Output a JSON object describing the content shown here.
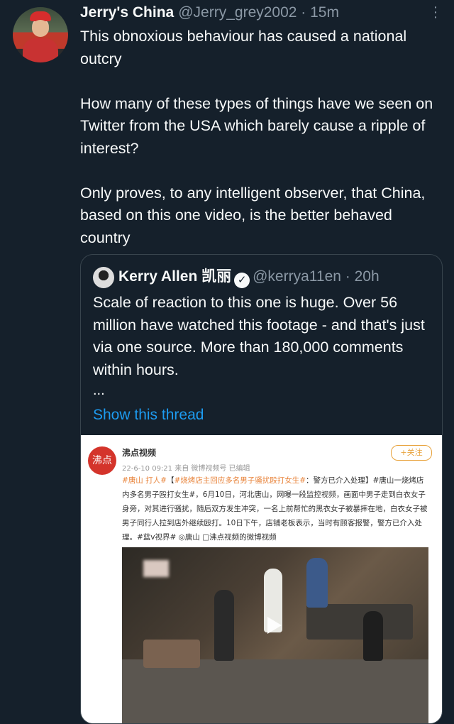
{
  "tweet": {
    "author_name": "Jerry's China",
    "handle_time": "@Jerry_grey2002 · 15m",
    "text": "This obnoxious behaviour has caused a national outcry\n\nHow many of these types of things have we seen on Twitter from the USA which barely cause a ripple of interest?\n\nOnly proves, to any intelligent observer, that China, based on this one video, is the better behaved country"
  },
  "quoted": {
    "author_name": "Kerry Allen 凯丽",
    "verified_mark": "✓",
    "handle_time": "@kerrya11en · 20h",
    "text": "Scale of reaction to this one is huge. Over 56 million have watched this footage - and that's just via one source. More than 180,000 comments within hours.",
    "ellipsis": "...",
    "show_thread": "Show this thread"
  },
  "weibo": {
    "logo_text": "沸点",
    "account": "沸点视频",
    "meta": "22-6-10 09:21 来自 微博视频号 已编辑",
    "follow": "+关注",
    "tag1": "#唐山 打人#",
    "tag2": "#烧烤店主回应多名男子骚扰殴打女生#",
    "post": "：警方已介入处理】#唐山一烧烤店内多名男子殴打女生#，6月10日，河北唐山，网曝一段监控视频，画面中男子走到白衣女子身旁，对其进行骚扰，随后双方发生冲突，一名上前帮忙的黑衣女子被暴摔在地，白衣女子被男子同行人拉到店外继续殴打。10日下午，店铺老板表示，当时有顾客报警，警方已介入处理。#蓝v视界# ◎唐山 □沸点视频的微博视频"
  },
  "colors": {
    "background": "#15202b",
    "text": "#f7f9f9",
    "muted": "#8b98a5",
    "link": "#1d9bf0",
    "border": "#38444d"
  }
}
